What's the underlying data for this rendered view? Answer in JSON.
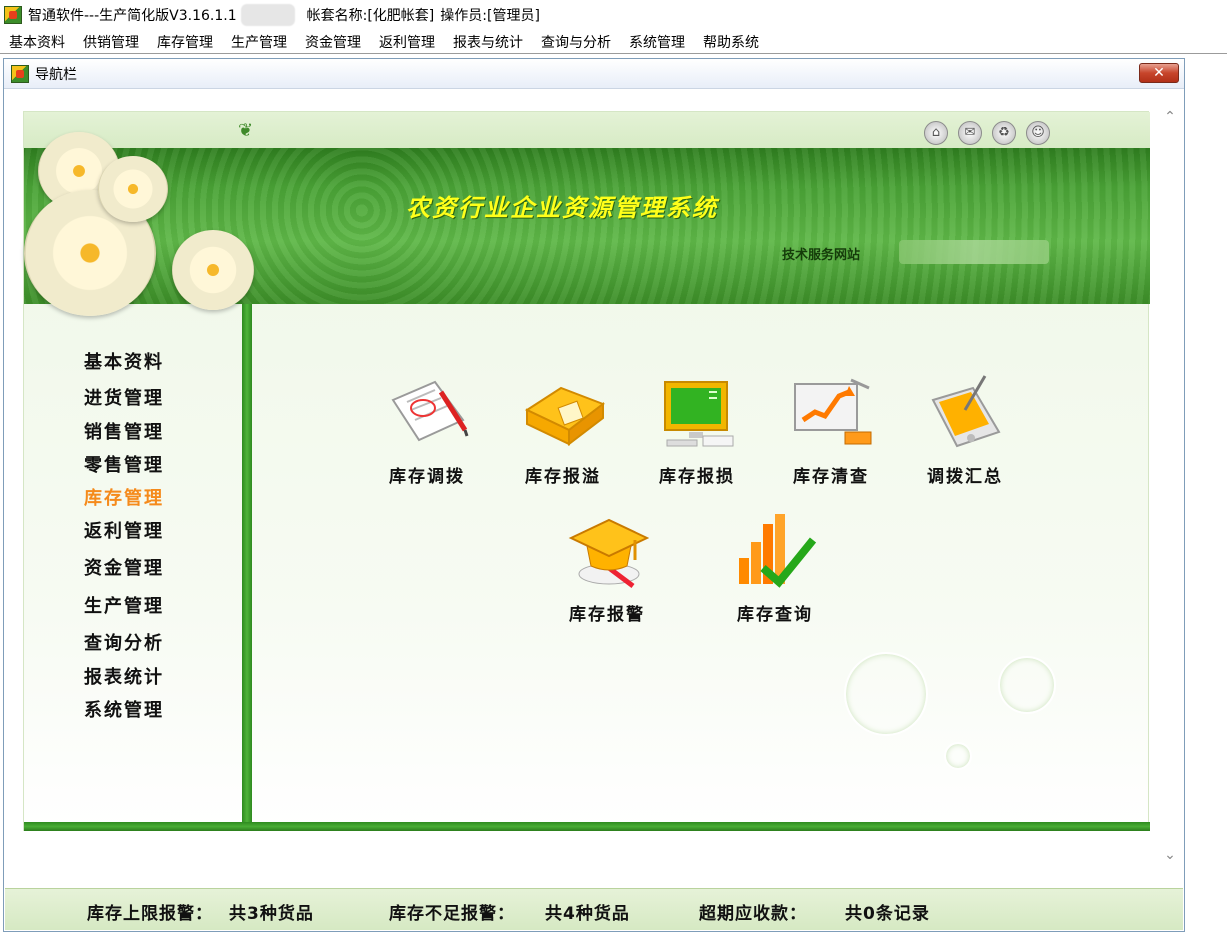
{
  "window": {
    "app_name": "智通软件---生产简化版V3.16.1.1",
    "account": "帐套名称:[化肥帐套]",
    "operator": "操作员:[管理员]"
  },
  "menubar": [
    "基本资料",
    "供销管理",
    "库存管理",
    "生产管理",
    "资金管理",
    "返利管理",
    "报表与统计",
    "查询与分析",
    "系统管理",
    "帮助系统"
  ],
  "child_window": {
    "title": "导航栏",
    "close_label": "✕"
  },
  "banner": {
    "title": "农资行业企业资源管理系统",
    "service_label": "技术服务网站"
  },
  "sidebar": {
    "items": [
      "基本资料",
      "进货管理",
      "销售管理",
      "零售管理",
      "库存管理",
      "返利管理",
      "资金管理",
      "生产管理",
      "查询分析",
      "报表统计",
      "系统管理"
    ],
    "active_index": 4
  },
  "modules": [
    {
      "label": "库存调拨",
      "icon": "document-pen-icon"
    },
    {
      "label": "库存报溢",
      "icon": "folder-icon"
    },
    {
      "label": "库存报损",
      "icon": "monitor-icon"
    },
    {
      "label": "库存清查",
      "icon": "chart-monitor-icon"
    },
    {
      "label": "调拨汇总",
      "icon": "pda-icon"
    },
    {
      "label": "库存报警",
      "icon": "graduation-cap-icon"
    },
    {
      "label": "库存查询",
      "icon": "bar-chart-check-icon"
    }
  ],
  "top_icons": [
    "home-icon",
    "mail-icon",
    "recycle-icon",
    "smile-icon"
  ],
  "colors": {
    "banner_green": "#4aa336",
    "banner_title": "#ffff1a",
    "active_item": "#f58a1b"
  },
  "statusbar": {
    "upper_alarm_label": "库存上限报警：",
    "upper_alarm_value": "共3种货品",
    "lower_alarm_label": "库存不足报警：",
    "lower_alarm_value": "共4种货品",
    "overdue_label": "超期应收款：",
    "overdue_value": "共0条记录"
  }
}
